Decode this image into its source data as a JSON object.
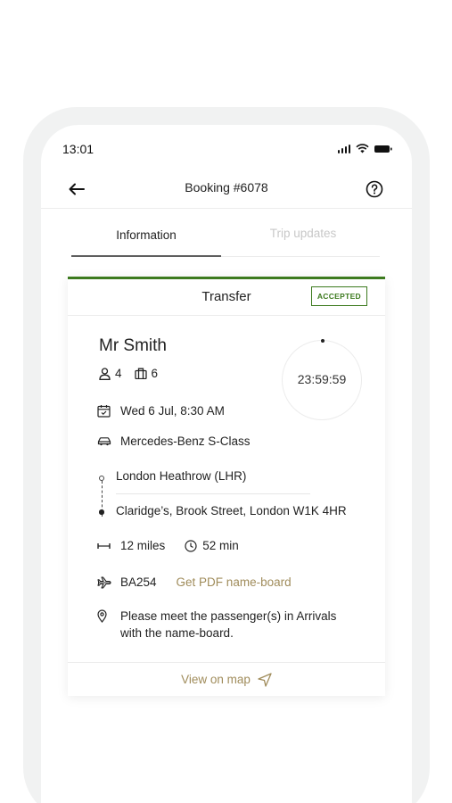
{
  "status_bar": {
    "time": "13:01"
  },
  "nav": {
    "title": "Booking #6078"
  },
  "tabs": [
    {
      "label": "Information",
      "active": true
    },
    {
      "label": "Trip updates",
      "active": false
    }
  ],
  "card": {
    "title": "Transfer",
    "badge": "ACCEPTED",
    "accent_color": "#3c7a1e",
    "passenger_name": "Mr Smith",
    "passengers_count": "4",
    "luggage_count": "6",
    "countdown": "23:59:59",
    "date_time": "Wed 6 Jul, 8:30 AM",
    "vehicle": "Mercedes-Benz S-Class",
    "pickup": "London Heathrow (LHR)",
    "dropoff": "Claridge’s, Brook Street, London W1K 4HR",
    "distance": "12 miles",
    "duration": "52 min",
    "flight": "BA254",
    "nameboard_link": "Get PDF name-board",
    "note": "Please meet the passenger(s) in Arrivals with the name-board.",
    "map_link": "View on map",
    "link_color": "#a08c5b"
  }
}
